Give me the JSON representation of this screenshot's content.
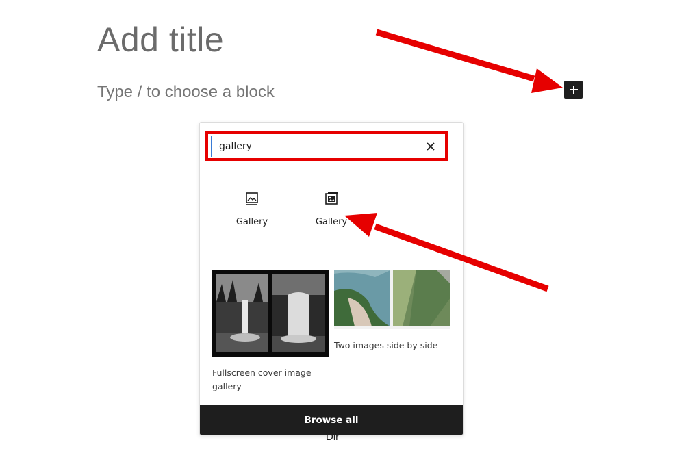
{
  "editor": {
    "title_placeholder": "Add title",
    "block_placeholder": "Type / to choose a block",
    "partial_text": "Dir"
  },
  "inserter": {
    "toggle_icon": "plus-icon",
    "search": {
      "value": "gallery",
      "clear_icon": "close-icon"
    },
    "blocks": [
      {
        "label": "Gallery",
        "icon": "gallery-icon"
      },
      {
        "label": "Gallery",
        "icon": "gallery-block-icon"
      }
    ],
    "patterns": [
      {
        "title_line1": "Fullscreen cover image",
        "title_line2": "gallery"
      },
      {
        "title_line1": "Two images side by side"
      }
    ],
    "browse_all_label": "Browse all"
  },
  "annotations": {
    "color": "#e60000"
  }
}
